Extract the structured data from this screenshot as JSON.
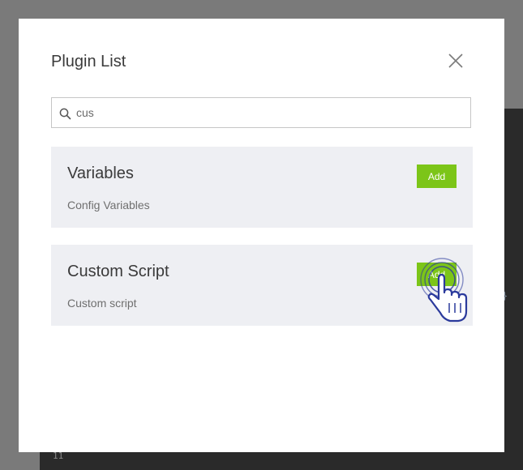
{
  "backdrop": {
    "line_number": "11",
    "brace": "}"
  },
  "modal": {
    "title": "Plugin List",
    "close_icon": "close-icon"
  },
  "search": {
    "value": "cus",
    "icon": "search-icon"
  },
  "plugins": [
    {
      "name": "Variables",
      "description": "Config Variables",
      "add_label": "Add"
    },
    {
      "name": "Custom Script",
      "description": "Custom script",
      "add_label": "Add"
    }
  ],
  "cursor": {
    "icon": "hand-pointer-icon"
  },
  "colors": {
    "accent": "#7cc518",
    "card_bg": "#eeeff3",
    "backdrop": "#7a7a7a",
    "cursor": "#2b3a9c"
  }
}
